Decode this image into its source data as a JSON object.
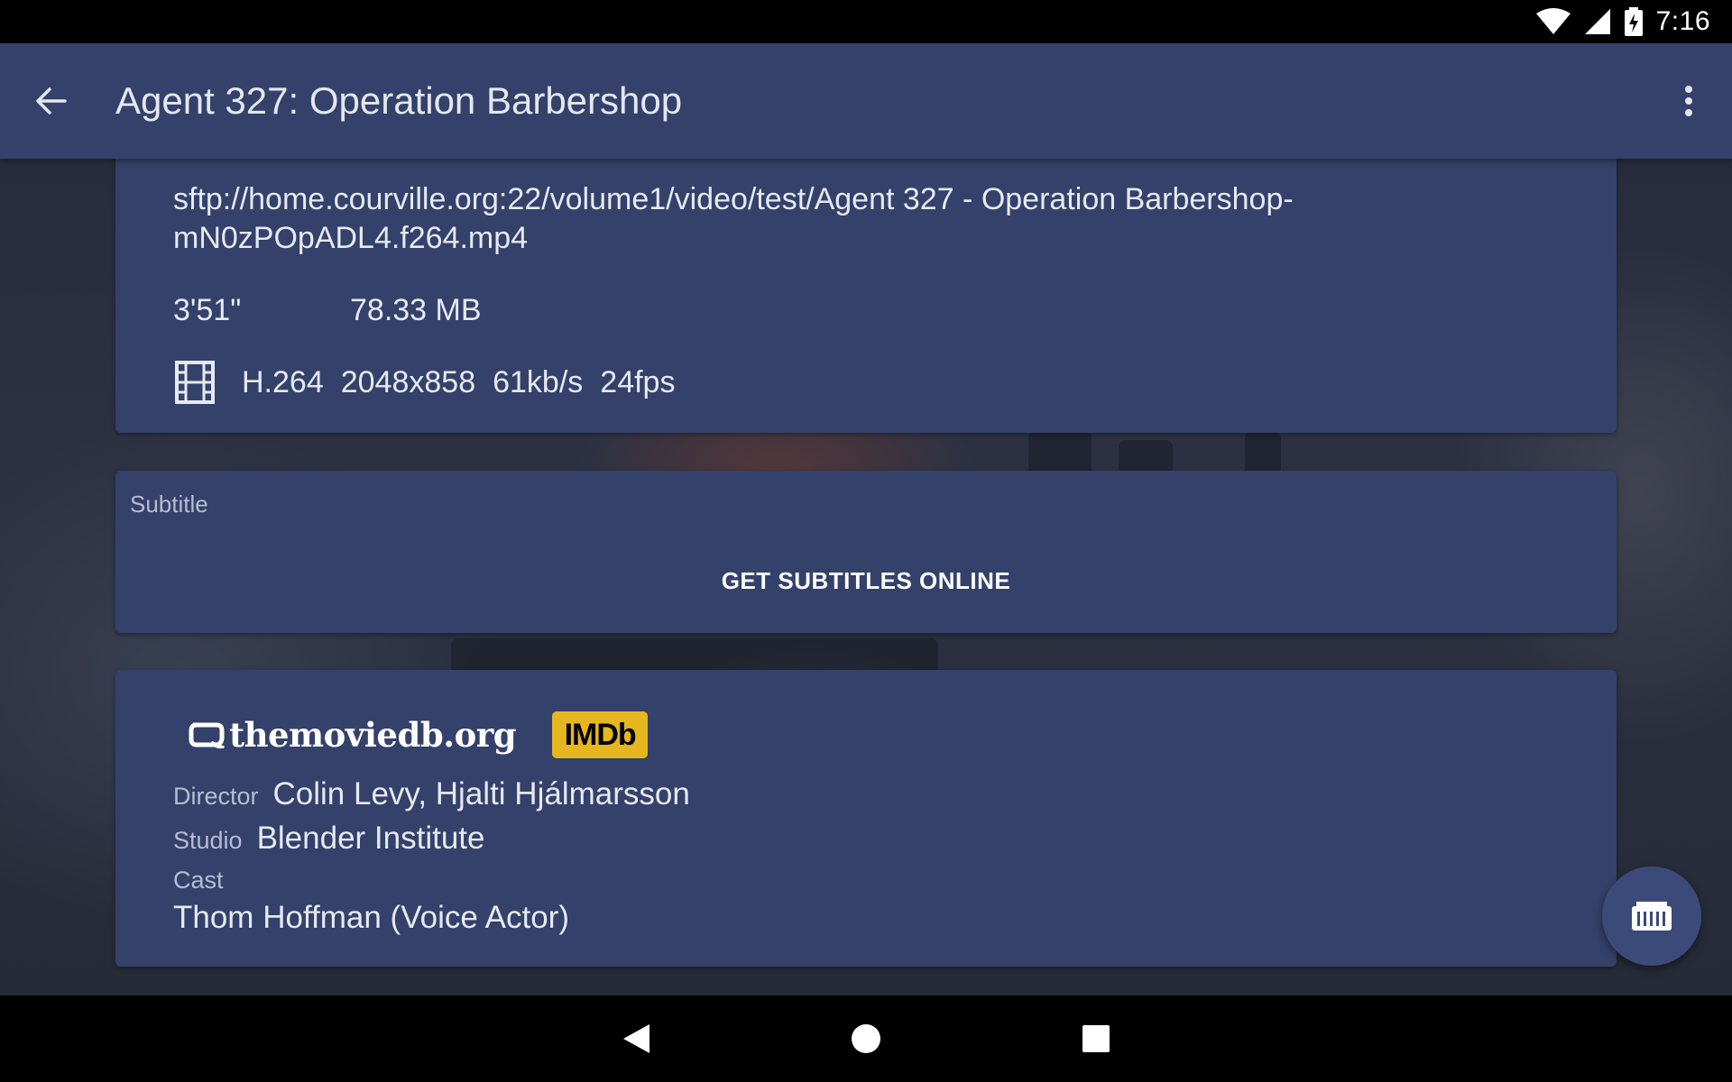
{
  "status_bar": {
    "time": "7:16",
    "icons": [
      "wifi-icon",
      "cell-signal-icon",
      "battery-charging-icon"
    ]
  },
  "app_bar": {
    "title": "Agent 327: Operation Barbershop",
    "back_icon": "arrow-back-icon",
    "menu_icon": "more-vert-icon"
  },
  "file_card": {
    "path": "sftp://home.courville.org:22/volume1/video/test/Agent 327 - Operation Barbershop-mN0zPOpADL4.f264.mp4",
    "duration": "3'51\"",
    "size": "78.33 MB",
    "codec_icon": "film-icon",
    "codec": "H.264",
    "resolution": "2048x858",
    "bitrate": "61kb/s",
    "framerate": "24fps"
  },
  "subtitle_card": {
    "label": "Subtitle",
    "button_label": "GET SUBTITLES ONLINE"
  },
  "info_card": {
    "tmdb_logo_text": "themoviedb.org",
    "imdb_logo_text": "IMDb",
    "director_label": "Director",
    "director_value": "Colin Levy, Hjalti Hjálmarsson",
    "studio_label": "Studio",
    "studio_value": "Blender Institute",
    "cast_label": "Cast",
    "cast_value": "Thom Hoffman (Voice Actor)"
  },
  "fab": {
    "icon": "library-icon"
  },
  "nav_bar": {
    "icons": [
      "nav-back-icon",
      "nav-home-icon",
      "nav-recents-icon"
    ]
  },
  "colors": {
    "surface": "#34416a",
    "fab": "#3b4a79",
    "imdb_yellow": "#e6b61f"
  }
}
